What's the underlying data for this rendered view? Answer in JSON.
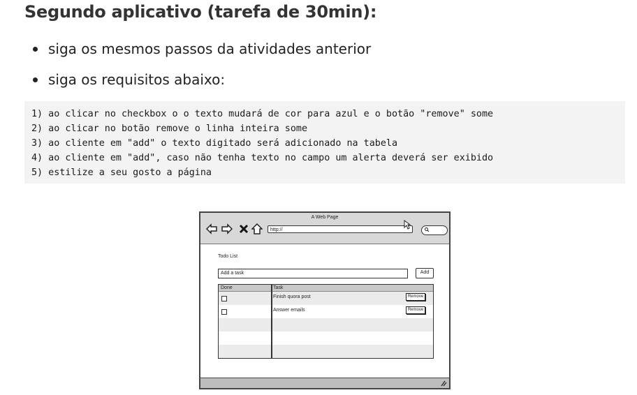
{
  "title": "Segundo aplicativo (tarefa de 30min):",
  "bullets": [
    "siga os mesmos passos da atividades anterior",
    "siga os requisitos abaixo:"
  ],
  "requirements": [
    "1) ao clicar no checkbox o o texto mudará de cor para azul e o botão \"remove\" some",
    "2) ao clicar no botão remove o linha inteira some",
    "3) ao cliente em \"add\" o texto digitado será adicionado na tabela",
    "4) ao cliente em \"add\", caso não tenha texto no campo um alerta deverá ser exibido",
    "5) estilize a seu gosto a página"
  ],
  "wireframe": {
    "page_title": "A Web Page",
    "url": "http://",
    "heading": "Todo List",
    "input_placeholder": "Add a task",
    "add_label": "Add",
    "columns": [
      "Done",
      "Task"
    ],
    "rows": [
      {
        "task": "Finish quora post",
        "remove_label": "Remove"
      },
      {
        "task": "Answer emails",
        "remove_label": "Remove"
      }
    ],
    "icons": [
      "back-arrow-icon",
      "forward-arrow-icon",
      "close-x-icon",
      "home-icon",
      "search-icon",
      "cursor-icon",
      "resize-grip-icon"
    ]
  }
}
